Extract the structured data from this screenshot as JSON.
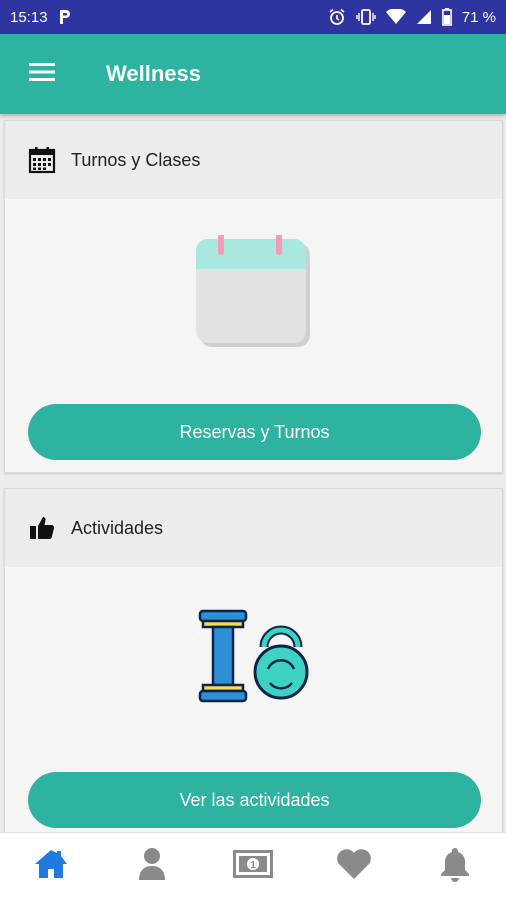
{
  "status_bar": {
    "time": "15:13",
    "notification_icon": "parking-p-icon",
    "battery_percent": "71 %",
    "icons": [
      "alarm-icon",
      "vibrate-icon",
      "wifi-icon",
      "signal-icon",
      "battery-icon"
    ]
  },
  "app_bar": {
    "title": "Wellness",
    "menu_icon": "hamburger-menu-icon"
  },
  "cards": [
    {
      "title": "Turnos y Clases",
      "icon": "calendar-icon",
      "illustration": "calendar-illustration",
      "button_label": "Reservas y Turnos"
    },
    {
      "title": "Actividades",
      "icon": "thumbs-up-icon",
      "illustration": "dumbbell-kettlebell-illustration",
      "button_label": "Ver las actividades"
    }
  ],
  "bottom_nav": {
    "items": [
      "home-icon",
      "profile-icon",
      "money-icon",
      "favorites-heart-icon",
      "notifications-bell-icon"
    ],
    "active": "home-icon"
  },
  "colors": {
    "status_bar": "#2f35a0",
    "primary": "#2db3a0",
    "active_nav": "#1f7be0",
    "inactive_nav": "#8a8a8a"
  }
}
